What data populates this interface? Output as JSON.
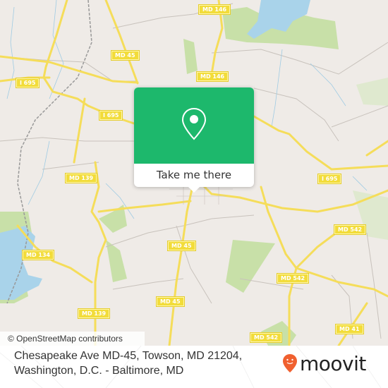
{
  "map": {
    "attribution": "© OpenStreetMap contributors",
    "road_labels": [
      {
        "text": "MD 146",
        "id": "md146-top"
      },
      {
        "text": "MD 45",
        "id": "md45-top"
      },
      {
        "text": "MD 146",
        "id": "md146-mid"
      },
      {
        "text": "I 695",
        "id": "i695-left"
      },
      {
        "text": "I 695",
        "id": "i695-center"
      },
      {
        "text": "MD 139",
        "id": "md139-upper"
      },
      {
        "text": "I 695",
        "id": "i695-right"
      },
      {
        "text": "MD 542",
        "id": "md542-right"
      },
      {
        "text": "MD 134",
        "id": "md134"
      },
      {
        "text": "MD 45",
        "id": "md45-mid"
      },
      {
        "text": "MD 542",
        "id": "md542-center"
      },
      {
        "text": "MD 45",
        "id": "md45-lower"
      },
      {
        "text": "MD 139",
        "id": "md139-lower"
      },
      {
        "text": "MD 41",
        "id": "md41"
      },
      {
        "text": "MD 542",
        "id": "md542-bottom"
      }
    ],
    "colors": {
      "background": "#efebe7",
      "road": "#f5dd5a",
      "water": "#a9d3ea",
      "park": "#c8e0a8",
      "marker_green": "#1db86c"
    }
  },
  "popup": {
    "icon": "location-pin-icon",
    "button_label": "Take me there"
  },
  "footer": {
    "address_line1": "Chesapeake Ave MD-45, Towson, MD 21204,",
    "address_line2": "Washington, D.C. - Baltimore, MD",
    "brand": "moovit",
    "brand_color": "#f0602f"
  }
}
